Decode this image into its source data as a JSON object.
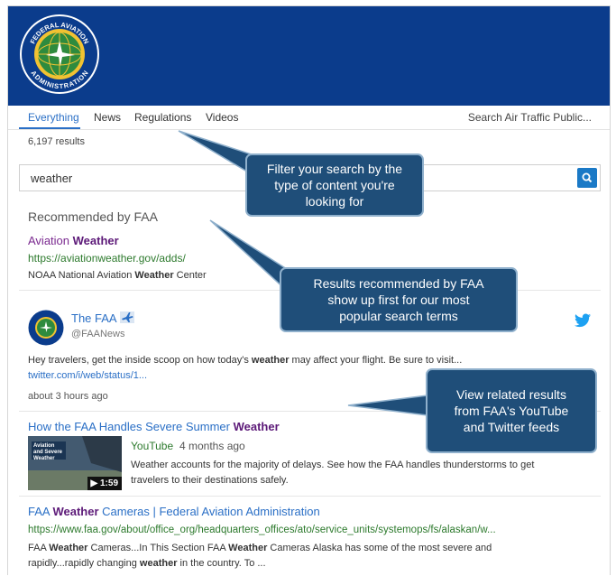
{
  "header": {
    "logo_text_top": "FEDERAL AVIATION",
    "logo_text_bottom": "ADMINISTRATION"
  },
  "tabs": [
    "Everything",
    "News",
    "Regulations",
    "Videos"
  ],
  "search_scope": "Search Air Traffic Public...",
  "results_count": "6,197 results",
  "search": {
    "value": "weather",
    "button_icon": "search-icon"
  },
  "recommended": {
    "heading": "Recommended by FAA",
    "title_prefix": "Aviation ",
    "title_bold": "Weather",
    "url": "https://aviationweather.gov/adds/",
    "snippet_prefix": "NOAA National Aviation ",
    "snippet_bold": "Weather",
    "snippet_suffix": " Center"
  },
  "tweet": {
    "name": "The FAA",
    "handle": "@FAANews",
    "text_prefix": "Hey travelers, get the inside scoop on how today's ",
    "text_bold": "weather",
    "text_suffix": " may affect your flight. Be sure to visit...",
    "link": "twitter.com/i/web/status/1...",
    "time": "about 3 hours ago",
    "avatar_icon": "faa-seal-icon",
    "service_icon": "twitter-bird-icon"
  },
  "video": {
    "title_prefix": "How the FAA Handles Severe Summer ",
    "title_bold": "Weather",
    "thumb_caption": "Aviation and Severe Weather",
    "duration": "1:59",
    "source": "YouTube",
    "age": "4 months ago",
    "desc_line1": "Weather accounts for the majority of delays. See how the FAA handles thunderstorms to get",
    "desc_line2": "travelers to their destinations safely."
  },
  "result4": {
    "title_pre": "FAA ",
    "title_bold": "Weather",
    "title_post": " Cameras | Federal Aviation Administration",
    "url": "https://www.faa.gov/about/office_org/headquarters_offices/ato/service_units/systemops/fs/alaskan/w...",
    "s1": "FAA ",
    "s1b": "Weather",
    "s2": " Cameras...In This Section FAA ",
    "s2b": "Weather",
    "s3": " Cameras Alaska has some of the most severe and",
    "s4": "rapidly...rapidly changing ",
    "s4b": "weather",
    "s5": " in the country. To ..."
  },
  "callouts": {
    "filter_l1": "Filter your search by the",
    "filter_l2": "type of content you're",
    "filter_l3": "looking for",
    "rec_l1": "Results recommended by FAA",
    "rec_l2": "show up first for our most",
    "rec_l3": "popular search terms",
    "related_l1": "View related results",
    "related_l2": "from FAA's YouTube",
    "related_l3": "and Twitter feeds"
  },
  "colors": {
    "header": "#0b3c8c",
    "callout": "#1f4e79",
    "link": "#2a6fc6",
    "url_green": "#2d7a2d",
    "visited_purple": "#7b2a90"
  }
}
